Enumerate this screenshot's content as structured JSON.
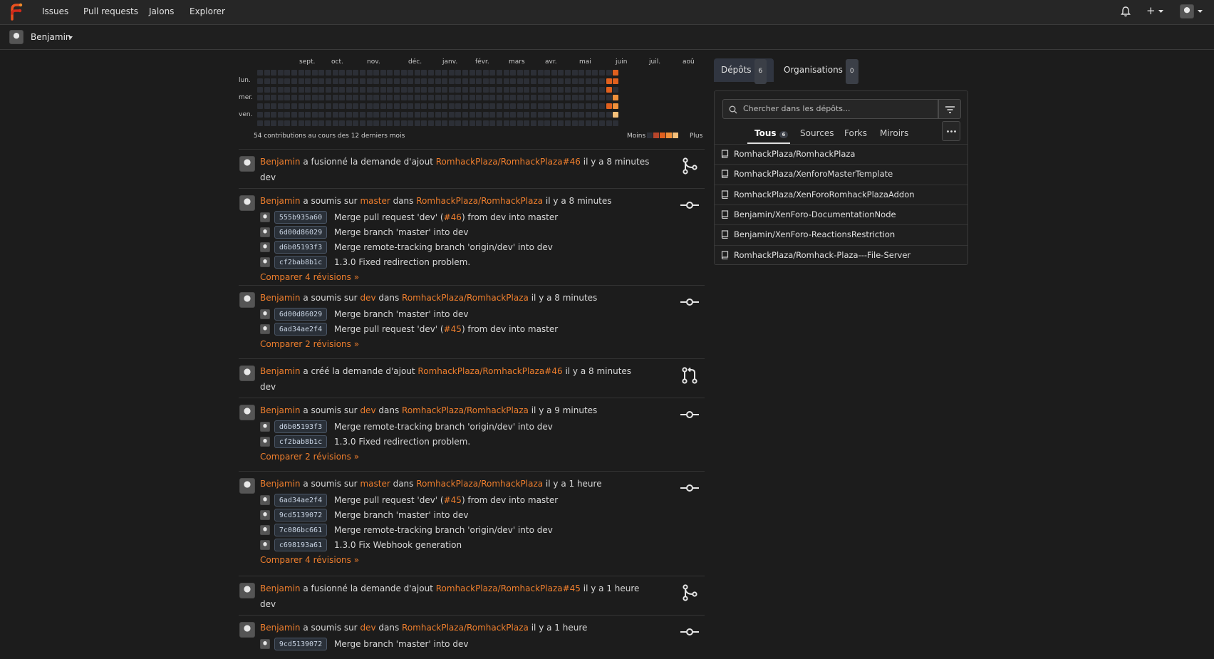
{
  "topbar": {
    "nav": [
      "Issues",
      "Pull requests",
      "Jalons",
      "Explorer"
    ],
    "plus_label": "+"
  },
  "user_bar": {
    "username": "Benjamin"
  },
  "heatmap": {
    "months": [
      "sept.",
      "oct.",
      "nov.",
      "déc.",
      "janv.",
      "févr.",
      "mars",
      "avr.",
      "mai",
      "juin",
      "juil.",
      "aoû"
    ],
    "days": [
      "lun.",
      "mer.",
      "ven."
    ],
    "summary": "54 contributions au cours des 12 derniers mois",
    "less": "Moins",
    "more": "Plus",
    "legend_colors": [
      "#2c2f36",
      "#b7452b",
      "#e0601e",
      "#f0903a",
      "#f6c07a"
    ],
    "active_cells": [
      {
        "week": 51,
        "day": 1,
        "level": 2
      },
      {
        "week": 51,
        "day": 2,
        "level": 2
      },
      {
        "week": 51,
        "day": 4,
        "level": 2
      },
      {
        "week": 52,
        "day": 0,
        "level": 2
      },
      {
        "week": 52,
        "day": 1,
        "level": 2
      },
      {
        "week": 52,
        "day": 3,
        "level": 3
      },
      {
        "week": 52,
        "day": 4,
        "level": 3
      },
      {
        "week": 52,
        "day": 5,
        "level": 4
      }
    ]
  },
  "feed": [
    {
      "type": "merge",
      "user": "Benjamin",
      "action": " a fusionné la demande d'ajout ",
      "target": "RomhackPlaza/RomhackPlaza#46",
      "time": " il y a 8 minutes",
      "detail": "dev"
    },
    {
      "type": "push",
      "user": "Benjamin",
      "action": " a soumis sur ",
      "branch": "master",
      "in": " dans ",
      "repo": "RomhackPlaza/RomhackPlaza",
      "time": " il y a 8 minutes",
      "commits": [
        {
          "sha": "555b935a60",
          "msg_pre": "Merge pull request 'dev' (",
          "link": "#46",
          "msg_post": ") from dev into master"
        },
        {
          "sha": "6d00d86029",
          "msg_pre": "Merge branch 'master' into dev"
        },
        {
          "sha": "d6b05193f3",
          "msg_pre": "Merge remote-tracking branch 'origin/dev' into dev"
        },
        {
          "sha": "cf2bab8b1c",
          "msg_pre": "1.3.0 Fixed redirection problem."
        }
      ],
      "compare": "Comparer 4 révisions »"
    },
    {
      "type": "push",
      "user": "Benjamin",
      "action": " a soumis sur ",
      "branch": "dev",
      "in": " dans ",
      "repo": "RomhackPlaza/RomhackPlaza",
      "time": " il y a 8 minutes",
      "commits": [
        {
          "sha": "6d00d86029",
          "msg_pre": "Merge branch 'master' into dev"
        },
        {
          "sha": "6ad34ae2f4",
          "msg_pre": "Merge pull request 'dev' (",
          "link": "#45",
          "msg_post": ") from dev into master"
        }
      ],
      "compare": "Comparer 2 révisions »"
    },
    {
      "type": "pr",
      "user": "Benjamin",
      "action": " a créé la demande d'ajout ",
      "target": "RomhackPlaza/RomhackPlaza#46",
      "time": " il y a 8 minutes",
      "detail": "dev"
    },
    {
      "type": "push",
      "user": "Benjamin",
      "action": " a soumis sur ",
      "branch": "dev",
      "in": " dans ",
      "repo": "RomhackPlaza/RomhackPlaza",
      "time": " il y a 9 minutes",
      "commits": [
        {
          "sha": "d6b05193f3",
          "msg_pre": "Merge remote-tracking branch 'origin/dev' into dev"
        },
        {
          "sha": "cf2bab8b1c",
          "msg_pre": "1.3.0 Fixed redirection problem."
        }
      ],
      "compare": "Comparer 2 révisions »"
    },
    {
      "type": "push",
      "user": "Benjamin",
      "action": " a soumis sur ",
      "branch": "master",
      "in": " dans ",
      "repo": "RomhackPlaza/RomhackPlaza",
      "time": " il y a 1 heure",
      "commits": [
        {
          "sha": "6ad34ae2f4",
          "msg_pre": "Merge pull request 'dev' (",
          "link": "#45",
          "msg_post": ") from dev into master"
        },
        {
          "sha": "9cd5139072",
          "msg_pre": "Merge branch 'master' into dev"
        },
        {
          "sha": "7c086bc661",
          "msg_pre": "Merge remote-tracking branch 'origin/dev' into dev"
        },
        {
          "sha": "c698193a61",
          "msg_pre": "1.3.0 Fix Webhook generation"
        }
      ],
      "compare": "Comparer 4 révisions »"
    },
    {
      "type": "merge",
      "user": "Benjamin",
      "action": " a fusionné la demande d'ajout ",
      "target": "RomhackPlaza/RomhackPlaza#45",
      "time": " il y a 1 heure",
      "detail": "dev"
    },
    {
      "type": "push",
      "user": "Benjamin",
      "action": " a soumis sur ",
      "branch": "dev",
      "in": " dans ",
      "repo": "RomhackPlaza/RomhackPlaza",
      "time": " il y a 1 heure",
      "commits": [
        {
          "sha": "9cd5139072",
          "msg_pre": "Merge branch 'master' into dev"
        }
      ]
    }
  ],
  "sidebar": {
    "tabs": [
      {
        "label": "Dépôts",
        "count": "6"
      },
      {
        "label": "Organisations",
        "count": "0"
      }
    ],
    "search_placeholder": "Chercher dans les dépôts...",
    "subtabs": [
      {
        "label": "Tous",
        "count": "6"
      },
      {
        "label": "Sources"
      },
      {
        "label": "Forks"
      },
      {
        "label": "Miroirs"
      }
    ],
    "repos": [
      "RomhackPlaza/RomhackPlaza",
      "RomhackPlaza/XenforoMasterTemplate",
      "RomhackPlaza/XenForoRomhackPlazaAddon",
      "Benjamin/XenForo-DocumentationNode",
      "Benjamin/XenForo-ReactionsRestriction",
      "RomhackPlaza/Romhack-Plaza---File-Server"
    ]
  }
}
